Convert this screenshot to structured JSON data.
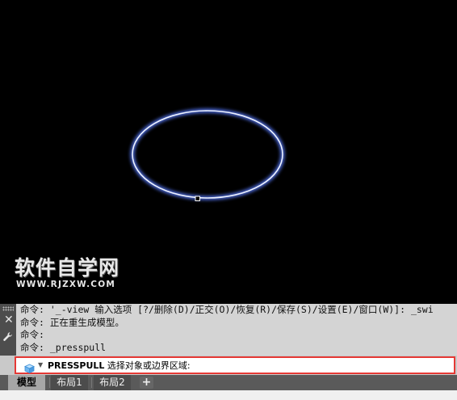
{
  "watermark": {
    "title": "软件自学网",
    "url": "WWW.RJZXW.COM"
  },
  "command_history": [
    "命令: '_-view 输入选项 [?/删除(D)/正交(O)/恢复(R)/保存(S)/设置(E)/窗口(W)]: _swi",
    "命令: 正在重生成模型。",
    "命令:",
    "命令: _presspull"
  ],
  "command_line": {
    "command": "PRESSPULL",
    "prompt": "选择对象或边界区域:"
  },
  "tabs": [
    {
      "label": "模型",
      "active": true
    },
    {
      "label": "布局1",
      "active": false
    },
    {
      "label": "布局2",
      "active": false
    }
  ],
  "add_tab_label": "+",
  "colors": {
    "ellipse_glow": "#5a7dff",
    "selection_highlight": "#e53935"
  }
}
